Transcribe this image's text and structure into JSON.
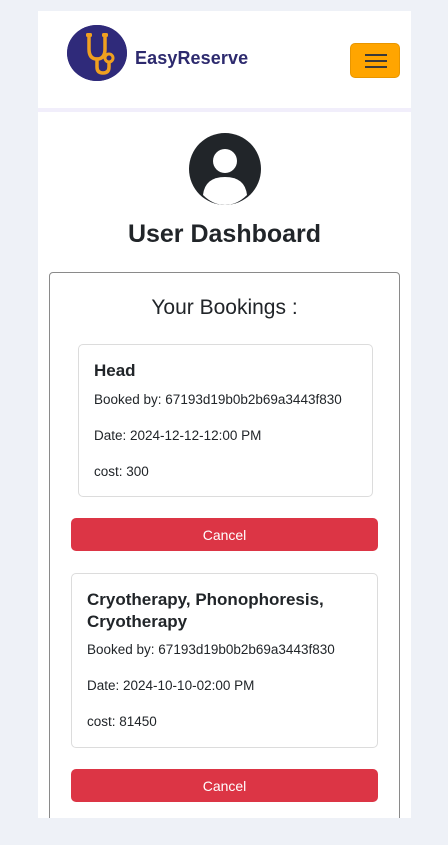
{
  "header": {
    "brand": "EasyReserve",
    "logo_icon": "stethoscope-icon",
    "menu_icon": "hamburger-menu-icon",
    "menu_color": "#ffa500"
  },
  "profile": {
    "avatar_icon": "user-circle-icon",
    "title": "User Dashboard"
  },
  "bookings": {
    "heading": "Your Bookings :",
    "items": [
      {
        "name": "Head",
        "booked_by": "Booked by: 67193d19b0b2b69a3443f830",
        "date": "Date: 2024-12-12-12:00 PM",
        "cost": "cost: 300",
        "cancel_label": "Cancel"
      },
      {
        "name": "Cryotherapy, Phonophoresis, Cryotherapy",
        "booked_by": "Booked by: 67193d19b0b2b69a3443f830",
        "date": "Date: 2024-10-10-02:00 PM",
        "cost": "cost: 81450",
        "cancel_label": "Cancel"
      }
    ]
  },
  "colors": {
    "background": "#eef1f7",
    "brand_text": "#2d2a6e",
    "cancel": "#dc3545"
  }
}
